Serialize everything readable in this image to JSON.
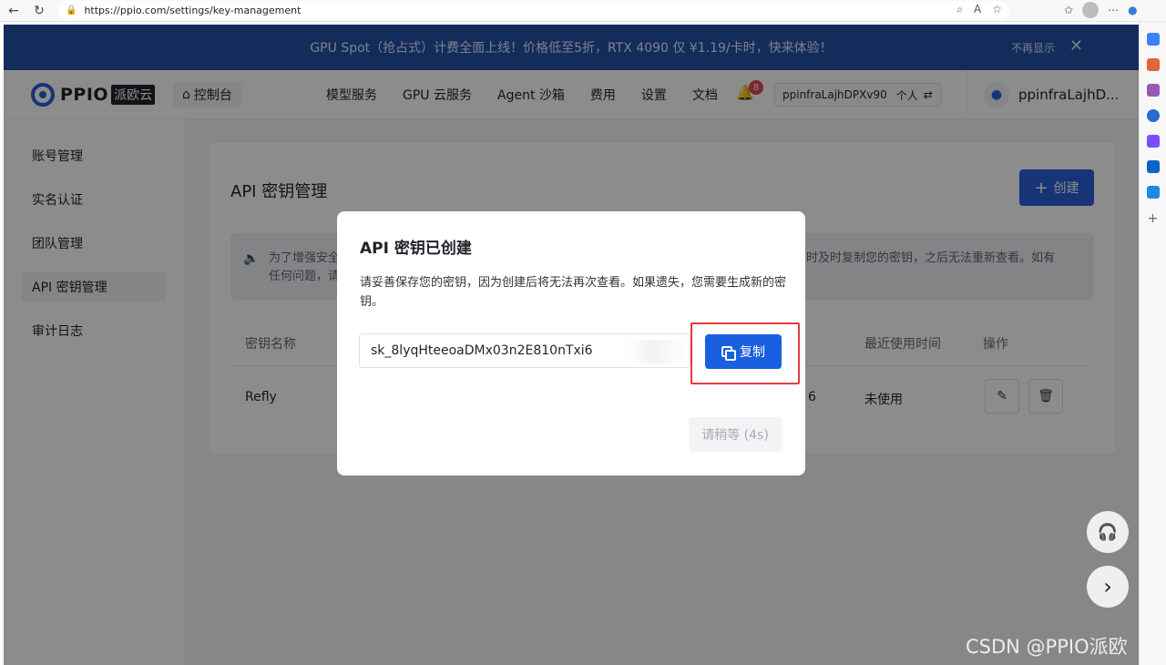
{
  "browser": {
    "url": "https://ppio.com/settings/key-management"
  },
  "banner": {
    "text": "GPU Spot（抢占式）计费全面上线！价格低至5折，RTX 4090 仅 ¥1.19/卡时，快来体验！",
    "dismiss": "不再显示",
    "close_glyph": "✕"
  },
  "header": {
    "logo_text": "PPIO",
    "logo_sub": "派欧云",
    "console_label": "控制台",
    "nav": [
      "模型服务",
      "GPU 云服务",
      "Agent 沙箱",
      "费用",
      "设置",
      "文档"
    ],
    "notification_count": "8",
    "account_id": "ppinfraLajhDPXv90",
    "account_type": "个人",
    "username": "ppinfraLajhD..."
  },
  "sidebar": {
    "items": [
      "账号管理",
      "实名认证",
      "团队管理",
      "API 密钥管理",
      "审计日志"
    ],
    "active_index": 3
  },
  "page": {
    "title": "API 密钥管理",
    "create_label": "创建",
    "notice_line1": "为了增强安全",
    "notice_line2": "任何问题，请",
    "notice_line3": "时及时复制您的密钥，之后无法重新查看。如有",
    "table": {
      "headers": [
        "密钥名称",
        "最近使用时间",
        "操作"
      ],
      "row": {
        "name": "Refly",
        "partial": "6",
        "last_used": "未使用"
      }
    }
  },
  "modal": {
    "title": "API 密钥已创建",
    "description": "请妥善保存您的密钥，因为创建后将无法再次查看。如果遗失，您需要生成新的密钥。",
    "key_value": "sk_8lyqHteeoaDMx03n2E810nTxi6",
    "copy_label": "复制",
    "wait_label": "请稍等 (4s)"
  },
  "watermark": "CSDN @PPIO派欧",
  "colors": {
    "banner": "#2351a8",
    "primary": "#2b5fd9",
    "highlight": "#e23b3b"
  },
  "icons": {
    "home": "⌂",
    "bell": "🔔",
    "swap": "⇄",
    "speaker": "🔈",
    "edit": "✎",
    "delete": "🗑",
    "headset": "🎧",
    "chevron": "›"
  }
}
